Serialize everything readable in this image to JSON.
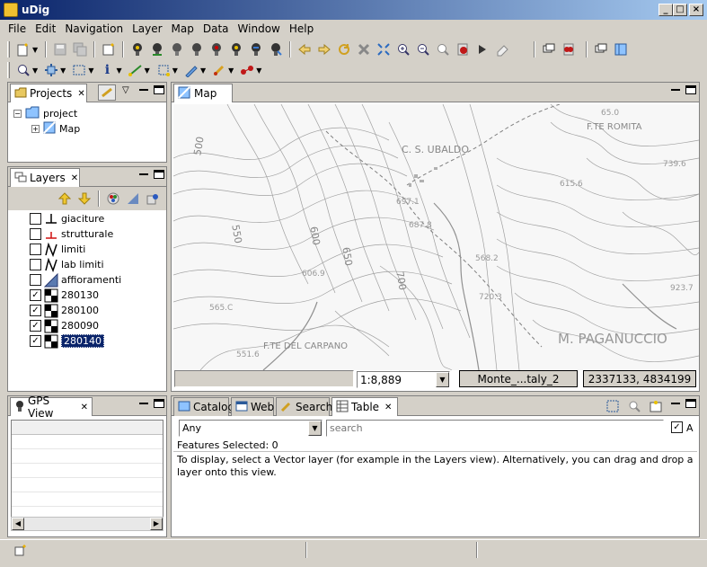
{
  "window": {
    "title": "uDig"
  },
  "menu": [
    "File",
    "Edit",
    "Navigation",
    "Layer",
    "Map",
    "Data",
    "Window",
    "Help"
  ],
  "projects_view": {
    "tab_label": "Projects",
    "tree": [
      {
        "label": "project"
      },
      {
        "label": "Map"
      }
    ]
  },
  "layers_view": {
    "tab_label": "Layers",
    "layers": [
      {
        "name": "giaciture",
        "checked": false,
        "icon": "point-symbol-icon"
      },
      {
        "name": "strutturale",
        "checked": false,
        "icon": "red-point-symbol-icon"
      },
      {
        "name": "limiti",
        "checked": false,
        "icon": "line-symbol-icon"
      },
      {
        "name": "lab limiti",
        "checked": false,
        "icon": "line-symbol-icon"
      },
      {
        "name": "affioramenti",
        "checked": false,
        "icon": "polygon-symbol-icon"
      },
      {
        "name": "280130",
        "checked": true,
        "icon": "raster-icon"
      },
      {
        "name": "280100",
        "checked": true,
        "icon": "raster-icon"
      },
      {
        "name": "280090",
        "checked": true,
        "icon": "raster-icon"
      },
      {
        "name": "280140",
        "checked": true,
        "icon": "raster-icon",
        "selected": true
      }
    ]
  },
  "map_view": {
    "tab_label": "Map",
    "scale": "1:8,889",
    "crs": "Monte_...taly_2",
    "coordinates": "2337133, 4834199",
    "map_labels": {
      "place1": "C. S. UBALDO",
      "place2": "F.TE ROMITA",
      "place3": "F.TE DEL CARPANO",
      "place4": "M. PAGANUCCIO",
      "contour1": "600",
      "contour2": "650",
      "contour3": "700",
      "contour4": "550",
      "contour5": "500",
      "spot1": "697.1",
      "spot2": "687.8",
      "spot3": "720.3",
      "spot4": "615.6",
      "spot5": "739.6",
      "spot6": "923.7",
      "spot7": "551.6",
      "spot8": "606.9",
      "spot9": "565.C",
      "spot10": "568.2",
      "spot11": "65.0"
    }
  },
  "gps_view": {
    "tab_label": "GPS View"
  },
  "bottom_tabs": [
    {
      "label": "Catalog"
    },
    {
      "label": "Web"
    },
    {
      "label": "Search"
    },
    {
      "label": "Table",
      "active": true
    }
  ],
  "table_view": {
    "filter_value": "Any",
    "search_placeholder": "search",
    "checkbox_label": "A",
    "features_selected": "Features Selected: 0",
    "message": "To display, select a Vector layer (for example in the Layers view). Alternatively, you can drag and drop a layer onto this view."
  }
}
